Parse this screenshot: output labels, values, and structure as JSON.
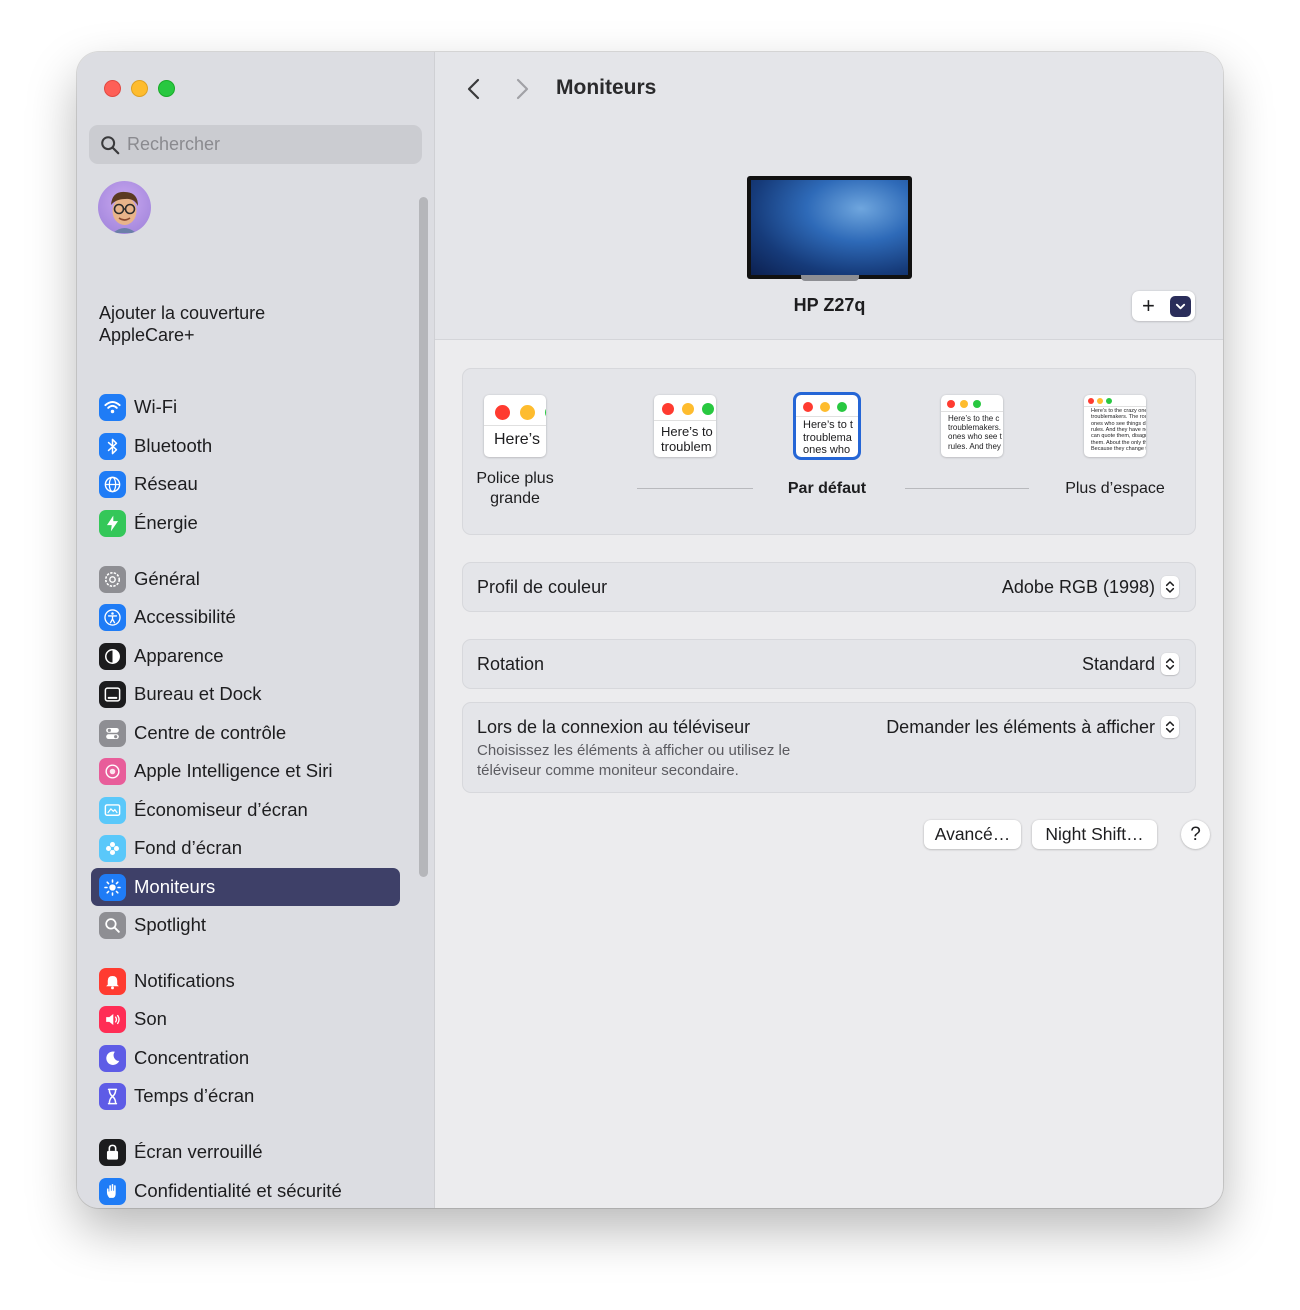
{
  "window": {
    "traffic_lights": [
      "close",
      "minimize",
      "zoom"
    ]
  },
  "sidebar": {
    "search_placeholder": "Rechercher",
    "applecare_label": "Ajouter la couverture AppleCare+",
    "items": [
      {
        "label": "Wi-Fi",
        "icon": "wifi-icon",
        "color": "#1f7cf6"
      },
      {
        "label": "Bluetooth",
        "icon": "bluetooth-icon",
        "color": "#1f7cf6"
      },
      {
        "label": "Réseau",
        "icon": "globe-icon",
        "color": "#1f7cf6"
      },
      {
        "label": "Énergie",
        "icon": "bolt-icon",
        "color": "#34c759"
      },
      {
        "label": "Général",
        "icon": "gear-icon",
        "color": "#8e8e93"
      },
      {
        "label": "Accessibilité",
        "icon": "accessibility-icon",
        "color": "#1f7cf6"
      },
      {
        "label": "Apparence",
        "icon": "appearance-icon",
        "color": "#1c1c1e"
      },
      {
        "label": "Bureau et Dock",
        "icon": "dock-icon",
        "color": "#1c1c1e"
      },
      {
        "label": "Centre de contrôle",
        "icon": "toggles-icon",
        "color": "#8e8e93"
      },
      {
        "label": "Apple Intelligence et Siri",
        "icon": "siri-icon",
        "color": "#e85d9a"
      },
      {
        "label": "Économiseur d’écran",
        "icon": "screensaver-icon",
        "color": "#5ac8fa"
      },
      {
        "label": "Fond d’écran",
        "icon": "flower-icon",
        "color": "#5ac8fa"
      },
      {
        "label": "Moniteurs",
        "icon": "sun-icon",
        "color": "#1f7cf6",
        "active": true
      },
      {
        "label": "Spotlight",
        "icon": "magnifier-icon",
        "color": "#8e8e93"
      },
      {
        "label": "Notifications",
        "icon": "bell-icon",
        "color": "#ff3b30"
      },
      {
        "label": "Son",
        "icon": "speaker-icon",
        "color": "#ff2d55"
      },
      {
        "label": "Concentration",
        "icon": "moon-icon",
        "color": "#5e5ce6"
      },
      {
        "label": "Temps d’écran",
        "icon": "hourglass-icon",
        "color": "#5e5ce6"
      },
      {
        "label": "Écran verrouillé",
        "icon": "lock-icon",
        "color": "#1c1c1e"
      },
      {
        "label": "Confidentialité et sécurité",
        "icon": "hand-icon",
        "color": "#1f7cf6"
      }
    ]
  },
  "main": {
    "title": "Moniteurs",
    "monitor_name": "HP Z27q",
    "add_label": "+",
    "resolution": {
      "options": [
        {
          "label": "Police plus grande",
          "sample": "Here’s"
        },
        {
          "label": "",
          "sample": "Here’s to\ntroublem"
        },
        {
          "label": "Par défaut",
          "sample": "Here’s to t\ntroublema\nones who",
          "selected": true
        },
        {
          "label": "",
          "sample": "Here’s to the c\ntroublemakers.\nones who see t\nrules. And they"
        },
        {
          "label": "Plus d’espace",
          "sample": "Here’s to the crazy one\ntroublemakers. The rou\nones who see things di\nrules. And they have no\ncan quote them, disagre\nthem. About the only th\nBecause they change t"
        }
      ]
    },
    "color_profile": {
      "label": "Profil de couleur",
      "value": "Adobe RGB (1998)"
    },
    "rotation": {
      "label": "Rotation",
      "value": "Standard"
    },
    "tv": {
      "label": "Lors de la connexion au téléviseur",
      "description": "Choisissez les éléments à afficher ou utilisez le téléviseur comme moniteur secondaire.",
      "value": "Demander les éléments à afficher"
    },
    "buttons": {
      "advanced": "Avancé…",
      "night_shift": "Night Shift…",
      "help": "?"
    }
  }
}
